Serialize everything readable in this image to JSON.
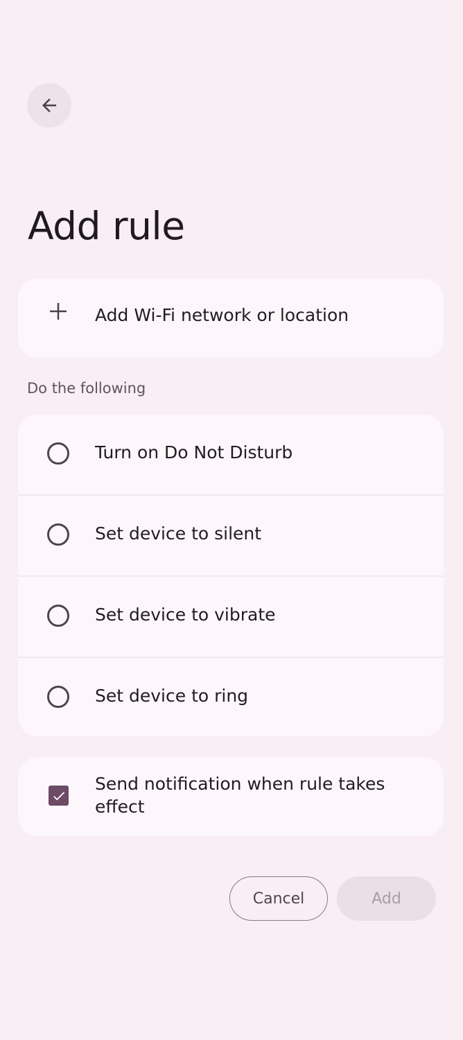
{
  "header": {
    "back_icon": "arrow-left-icon",
    "title": "Add rule"
  },
  "trigger": {
    "icon": "plus-icon",
    "label": "Add Wi-Fi network or location"
  },
  "actions": {
    "section_title": "Do the following",
    "options": [
      {
        "label": "Turn on Do Not Disturb",
        "selected": false
      },
      {
        "label": "Set device to silent",
        "selected": false
      },
      {
        "label": "Set device to vibrate",
        "selected": false
      },
      {
        "label": "Set device to ring",
        "selected": false
      }
    ]
  },
  "notification": {
    "label": "Send notification when rule takes effect",
    "checked": true
  },
  "buttons": {
    "cancel": "Cancel",
    "add": "Add",
    "add_enabled": false
  },
  "colors": {
    "background": "#f8eef4",
    "card": "#fdf6fa",
    "accent": "#6d4a66",
    "disabled_button": "#e9dfe5"
  }
}
